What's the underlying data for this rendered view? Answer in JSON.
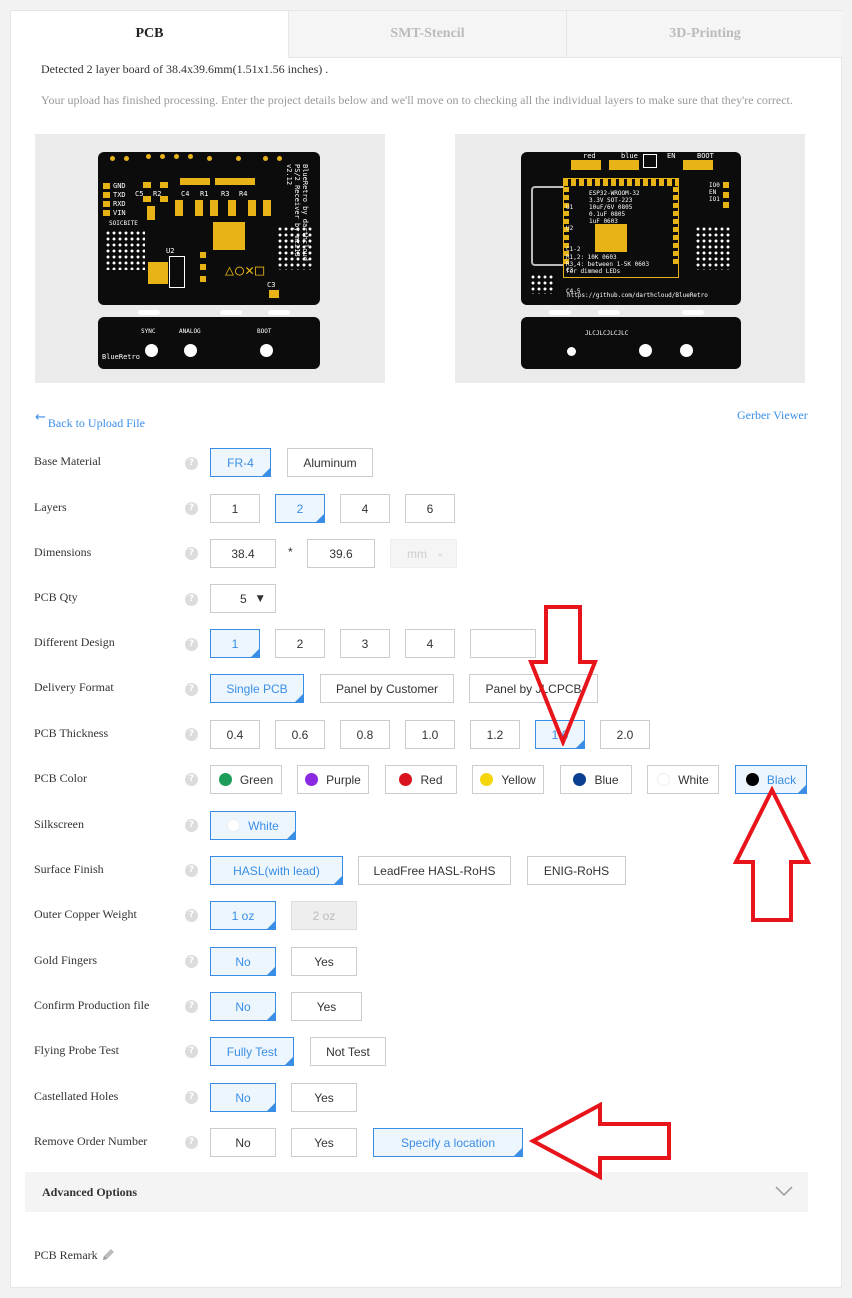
{
  "tabs": [
    {
      "label": "PCB",
      "active": true
    },
    {
      "label": "SMT-Stencil",
      "active": false
    },
    {
      "label": "3D-Printing",
      "active": false
    }
  ],
  "info": {
    "detected": "Detected 2 layer board of 38.4x39.6mm(1.51x1.56 inches) .",
    "processing": "Your upload has finished processing. Enter the project details below and we'll move on to checking all the individual layers to make sure that they're correct."
  },
  "top_preview": {
    "silk_right": "BlueRetro by darthcloud\nPS/2 Receiver by mz213\nv2.12",
    "pin_labels": [
      "GND",
      "TXD",
      "RXD",
      "VIN"
    ],
    "part_labels": [
      "C5",
      "R2",
      "C4",
      "R1",
      "R3",
      "R4",
      "U2",
      "C3"
    ],
    "esp_label": "SOICBITE",
    "shapes": "△○✕□",
    "connector_labels": [
      "SYNC",
      "ANALOG",
      "BOOT"
    ],
    "brand": "BlueRetro"
  },
  "bottom_preview": {
    "top_labels": [
      "red",
      "blue",
      "EN",
      "BOOT"
    ],
    "module_text": "ESP32-WROOM-32\n3.3V SOT-223\n10uF/6V 0805\n0.1uF 0805\n1uF 0603",
    "module_labels": [
      "U1",
      "U2",
      "C1-2",
      "C3",
      "C4-5"
    ],
    "resistor_text": "R1,2: 10K 0603\nR3,4: between 1-5K 0603\nfor dimmed LEDs",
    "url": "https://github.com/darthcloud/BlueRetro",
    "side_labels": [
      "IO0",
      "EN",
      "IO1"
    ],
    "bottom_row": "JLCJLCJLCJLC"
  },
  "nav": {
    "back": "Back to Upload File",
    "gerber": "Gerber Viewer"
  },
  "form": {
    "base_material": {
      "label": "Base Material",
      "options": [
        "FR-4",
        "Aluminum"
      ],
      "selected": "FR-4"
    },
    "layers": {
      "label": "Layers",
      "options": [
        "1",
        "2",
        "4",
        "6"
      ],
      "selected": "2"
    },
    "dimensions": {
      "label": "Dimensions",
      "width": "38.4",
      "height": "39.6",
      "sep": "*",
      "unit": "mm"
    },
    "pcb_qty": {
      "label": "PCB Qty",
      "value": "5"
    },
    "different_design": {
      "label": "Different Design",
      "options": [
        "1",
        "2",
        "3",
        "4"
      ],
      "selected": "1"
    },
    "delivery_format": {
      "label": "Delivery Format",
      "options": [
        "Single PCB",
        "Panel by Customer",
        "Panel by JLCPCB"
      ],
      "selected": "Single PCB"
    },
    "pcb_thickness": {
      "label": "PCB Thickness",
      "options": [
        "0.4",
        "0.6",
        "0.8",
        "1.0",
        "1.2",
        "1.6",
        "2.0"
      ],
      "selected": "1.6"
    },
    "pcb_color": {
      "label": "PCB Color",
      "options": [
        {
          "name": "Green",
          "color": "#1e9c5a"
        },
        {
          "name": "Purple",
          "color": "#8a2be2"
        },
        {
          "name": "Red",
          "color": "#d9141e"
        },
        {
          "name": "Yellow",
          "color": "#f5d60c"
        },
        {
          "name": "Blue",
          "color": "#0b3f8f"
        },
        {
          "name": "White",
          "color": "#ffffff"
        },
        {
          "name": "Black",
          "color": "#000000"
        }
      ],
      "selected": "Black"
    },
    "silkscreen": {
      "label": "Silkscreen",
      "value": "White",
      "color": "#ffffff"
    },
    "surface_finish": {
      "label": "Surface Finish",
      "options": [
        "HASL(with lead)",
        "LeadFree HASL-RoHS",
        "ENIG-RoHS"
      ],
      "selected": "HASL(with lead)"
    },
    "outer_copper": {
      "label": "Outer Copper Weight",
      "options": [
        "1 oz",
        "2 oz"
      ],
      "selected": "1 oz",
      "disabled": "2 oz"
    },
    "gold_fingers": {
      "label": "Gold Fingers",
      "options": [
        "No",
        "Yes"
      ],
      "selected": "No"
    },
    "confirm_production": {
      "label": "Confirm Production file",
      "options": [
        "No",
        "Yes"
      ],
      "selected": "No"
    },
    "flying_probe": {
      "label": "Flying Probe Test",
      "options": [
        "Fully Test",
        "Not Test"
      ],
      "selected": "Fully Test"
    },
    "castellated": {
      "label": "Castellated Holes",
      "options": [
        "No",
        "Yes"
      ],
      "selected": "No"
    },
    "remove_order_number": {
      "label": "Remove Order Number",
      "options": [
        "No",
        "Yes",
        "Specify a location"
      ],
      "selected": "Specify a location"
    }
  },
  "advanced": {
    "label": "Advanced Options"
  },
  "remark": {
    "label": "PCB Remark"
  },
  "colors": {
    "accent": "#3a8ee6",
    "annotation": "#e8141b"
  }
}
